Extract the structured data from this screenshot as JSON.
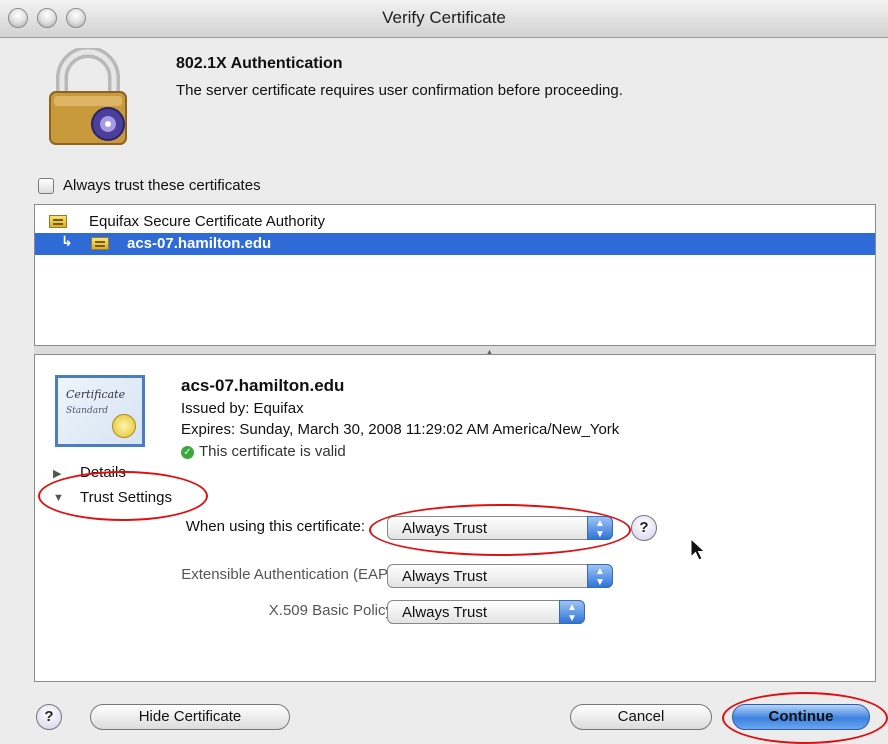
{
  "window": {
    "title": "Verify Certificate"
  },
  "header": {
    "title": "802.1X Authentication",
    "message": "The server certificate requires user confirmation before proceeding."
  },
  "trust_checkbox": {
    "label": "Always trust these certificates",
    "checked": false
  },
  "cert_list": {
    "items": [
      {
        "label": "Equifax Secure Certificate Authority",
        "selected": false
      },
      {
        "label": "acs-07.hamilton.edu",
        "selected": true
      }
    ]
  },
  "certificate": {
    "name": "acs-07.hamilton.edu",
    "issued_by": "Issued by: Equifax",
    "expires": "Expires: Sunday, March 30, 2008 11:29:02 AM America/New_York",
    "status": "This certificate is valid",
    "status_color": "#3aa83a"
  },
  "sections": {
    "details": "Details",
    "trust": "Trust Settings"
  },
  "trust": {
    "use_label": "When using this certificate:",
    "use_value": "Always Trust",
    "eap_label": "Extensible Authentication (EAP)",
    "eap_value": "Always Trust",
    "x509_label": "X.509 Basic Policy",
    "x509_value": "Always Trust"
  },
  "buttons": {
    "help": "?",
    "hide_certificate": "Hide Certificate",
    "cancel": "Cancel",
    "continue": "Continue"
  },
  "colors": {
    "selection": "#2e6bd6",
    "annotation": "#dd1111",
    "accent": "#3d82e0"
  }
}
